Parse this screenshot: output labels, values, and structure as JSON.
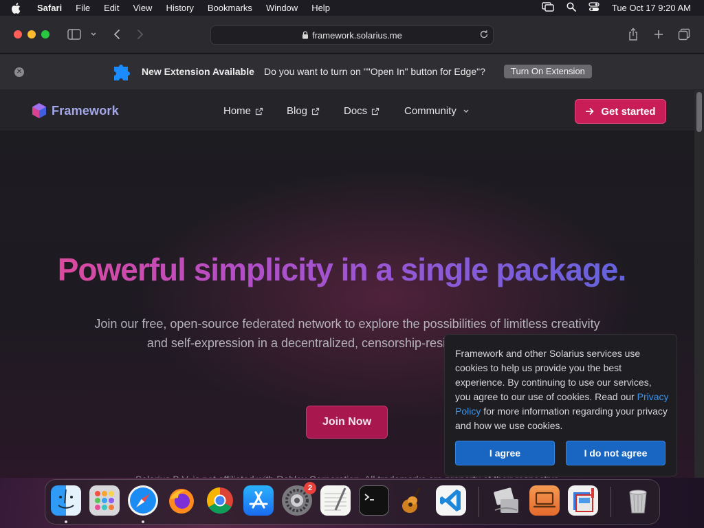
{
  "menubar": {
    "app_name": "Safari",
    "items": [
      "File",
      "Edit",
      "View",
      "History",
      "Bookmarks",
      "Window",
      "Help"
    ],
    "clock": "Tue Oct 17  9:20 AM",
    "icons": [
      "apple-icon",
      "screen-mirroring-icon",
      "spotlight-search-icon",
      "control-center-icon"
    ]
  },
  "browser": {
    "url": "framework.solarius.me",
    "toolbar_icons": [
      "sidebar-icon",
      "chevron-down-icon",
      "back-icon",
      "forward-icon",
      "share-icon",
      "new-tab-icon",
      "tab-overview-icon",
      "lock-icon",
      "reload-icon"
    ]
  },
  "extension_banner": {
    "title": "New Extension Available",
    "message": "Do you want to turn on \"\"Open In\" button for Edge\"?",
    "button": "Turn On Extension",
    "icon": "puzzle-piece-icon"
  },
  "site": {
    "brand": "Framework",
    "nav": [
      {
        "label": "Home",
        "icon": "external-link-icon"
      },
      {
        "label": "Blog",
        "icon": "external-link-icon"
      },
      {
        "label": "Docs",
        "icon": "external-link-icon"
      },
      {
        "label": "Community",
        "icon": "chevron-down-icon"
      }
    ],
    "cta": "Get started",
    "hero_title": "Powerful simplicity in a single package.",
    "hero_subtitle": "Join our free, open-source federated network to explore the possibilities of limitless creativity and self-expression in a decentralized, censorship-resistant environment.",
    "join_button": "Join Now",
    "disclaimer": "Solarius B.V. is not affiliated with Roblox Corporation. All trademarks are property of their respective owners.",
    "colors": {
      "accent": "#c81d56",
      "gradient_start": "#e8488f",
      "gradient_end": "#5666dd",
      "link": "#3d92e8",
      "cookie_button": "#1866c2"
    }
  },
  "cookie": {
    "text_before": "Framework and other Solarius services use cookies to help us provide you the best experience. By continuing to use our services, you agree to our use of cookies. Read our ",
    "link": "Privacy Policy",
    "text_after": " for more information regarding your privacy and how we use cookies.",
    "agree": "I agree",
    "disagree": "I do not agree"
  },
  "dock": {
    "apps": [
      "Finder",
      "Launchpad",
      "Safari",
      "Firefox",
      "Chrome",
      "App Store",
      "System Settings",
      "TextEdit",
      "Terminal",
      "GarageBand",
      "Visual Studio Code",
      "Migration Assistant",
      "Remote Desktop",
      "Preview",
      "Trash"
    ],
    "settings_badge": "2"
  }
}
